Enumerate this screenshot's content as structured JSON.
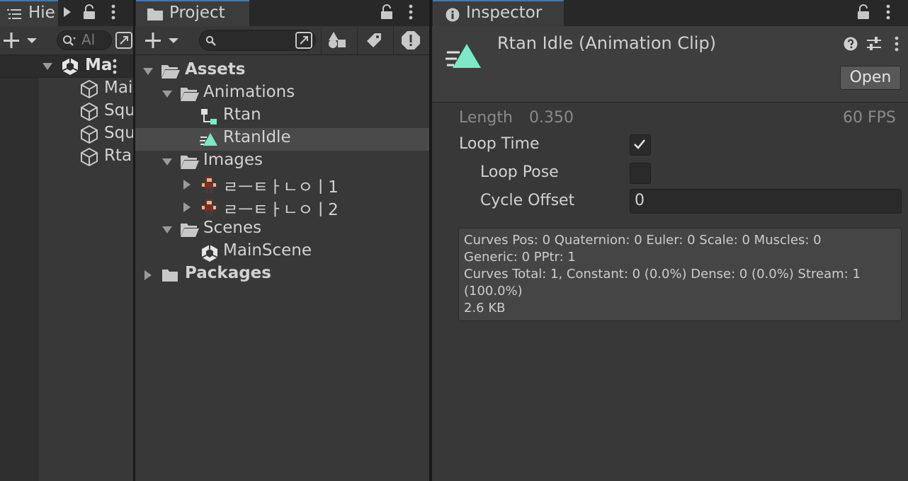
{
  "hierarchy": {
    "tab_label": "Hie",
    "search_placeholder": "Al",
    "scene_label": "Ma",
    "items": [
      {
        "label": "Mai"
      },
      {
        "label": "Squ"
      },
      {
        "label": "Squ"
      },
      {
        "label": "Rta"
      }
    ]
  },
  "project": {
    "tab_label": "Project",
    "tree": {
      "assets": "Assets",
      "animations": "Animations",
      "rtan": "Rtan",
      "rtanidle": "RtanIdle",
      "images": "Images",
      "image1": "ㄹㅡㅌㅏㄴㅇㅣ1",
      "image2": "ㄹㅡㅌㅏㄴㅇㅣ2",
      "scenes": "Scenes",
      "mainscene": "MainScene",
      "packages": "Packages"
    }
  },
  "inspector": {
    "tab_label": "Inspector",
    "title": "Rtan Idle (Animation Clip)",
    "open_label": "Open",
    "length_label": "Length",
    "length_value": "0.350",
    "fps_label": "60 FPS",
    "loop_time_label": "Loop Time",
    "loop_time_checked": true,
    "loop_pose_label": "Loop Pose",
    "loop_pose_checked": false,
    "cycle_offset_label": "Cycle Offset",
    "cycle_offset_value": "0",
    "info_lines": [
      "Curves Pos: 0 Quaternion: 0 Euler: 0 Scale: 0 Muscles: 0",
      "Generic: 0 PPtr: 1",
      "Curves Total: 1, Constant: 0 (0.0%) Dense: 0 (0.0%) Stream: 1",
      "(100.0%)",
      "2.6 KB"
    ]
  },
  "colors": {
    "accent": "#3a79bb",
    "animation_icon": "#7ee8c8",
    "panel_bg": "#383838",
    "selected_row": "#4a4a4a"
  }
}
